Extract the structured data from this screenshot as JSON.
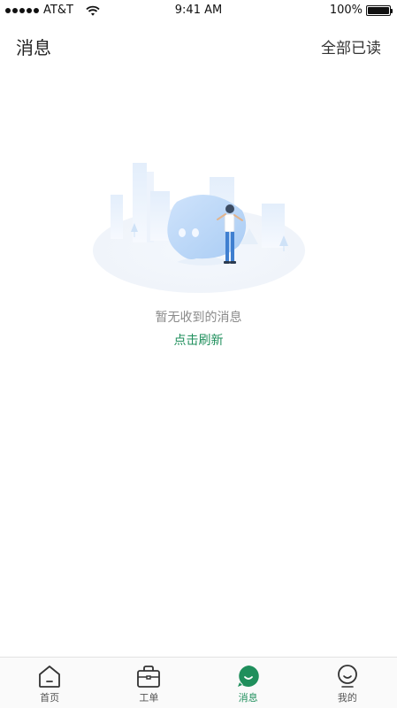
{
  "status_bar": {
    "carrier": "AT&T",
    "time": "9:41 AM",
    "battery": "100%",
    "battery_level": 1.0
  },
  "nav": {
    "title": "消息",
    "action": "全部已读"
  },
  "empty_state": {
    "message": "暂无收到的消息",
    "refresh_label": "点击刷新"
  },
  "tab_bar": {
    "active_color": "#1f8f5c",
    "items": [
      {
        "label": "首页",
        "icon": "home-icon"
      },
      {
        "label": "工单",
        "icon": "briefcase-icon"
      },
      {
        "label": "消息",
        "icon": "message-icon"
      },
      {
        "label": "我的",
        "icon": "profile-icon"
      }
    ]
  }
}
